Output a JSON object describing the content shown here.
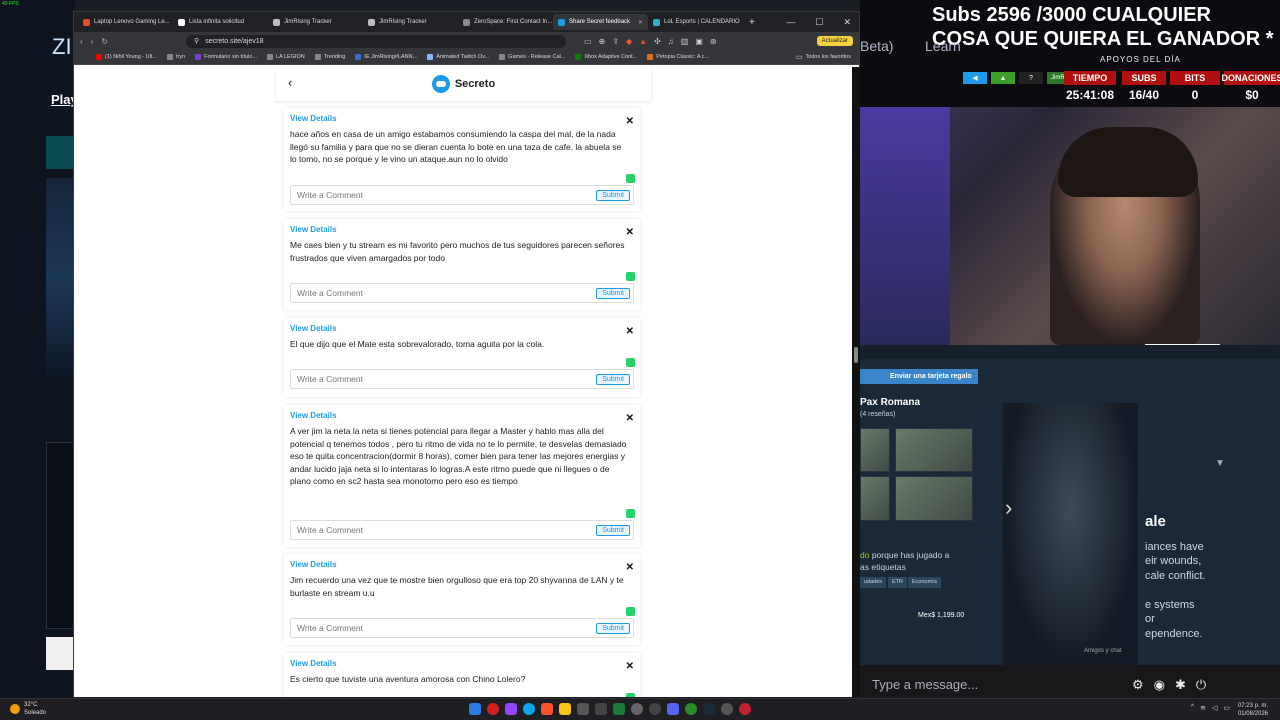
{
  "overlay": {
    "fps": "40 FPS",
    "subs_line1": "Subs 2596 /3000 CUALQUIER",
    "subs_line2": "COSA QUE QUIERA EL GANADOR *",
    "beta": "Beta)",
    "learn": "Learn",
    "apoyos": "APOYOS DEL DÍA",
    "twitch_name": "JimRising",
    "stats": [
      {
        "label": "TIEMPO",
        "value": "25:41:08"
      },
      {
        "label": "SUBS",
        "value": "16/40"
      },
      {
        "label": "BITS",
        "value": "0"
      },
      {
        "label": "DONACIONES",
        "value": "$0"
      }
    ]
  },
  "bg": {
    "zi": "ZI",
    "play": "Play",
    "p": "P",
    "f": "F"
  },
  "browser": {
    "tabs": [
      {
        "title": "Laptop Lenovo Gaming Le...",
        "color": "#e0502d"
      },
      {
        "title": "Lista infinita solicitud",
        "color": "#ffffff"
      },
      {
        "title": "JimRising Tracker",
        "color": "#bbbbbb"
      },
      {
        "title": "JimRising Tracker",
        "color": "#bbbbbb"
      },
      {
        "title": "ZeroSpace: First Contact In...",
        "color": "#888888"
      },
      {
        "title": "Share Secret feedback",
        "color": "#1e9be8",
        "active": true
      },
      {
        "title": "LoL Esports | CALENDARIO",
        "color": "#2db3c9"
      }
    ],
    "url": "secreto.site/ajev18",
    "update_label": "Actualizar",
    "bookmarks": [
      {
        "label": "(1) Nihil Young - Ult...",
        "color": "#ff0000"
      },
      {
        "label": "tryn",
        "color": "#888888"
      },
      {
        "label": "Formulario sin título...",
        "color": "#7b3fd1"
      },
      {
        "label": "LA LEGION",
        "color": "#888888"
      },
      {
        "label": "Trending",
        "color": "#888888"
      },
      {
        "label": "IE JimRising#LANN...",
        "color": "#3a6bd1"
      },
      {
        "label": "Animated Twitch Ov...",
        "color": "#8ab4f8"
      },
      {
        "label": "Games - Release Cal...",
        "color": "#888888"
      },
      {
        "label": "Xbox Adaptive Cont...",
        "color": "#107c10"
      },
      {
        "label": "Petopia Classic: A c...",
        "color": "#e07020"
      }
    ],
    "bookmarks_right": "Todos los favoritos"
  },
  "app": {
    "title": "Secreto",
    "view_details": "View Details",
    "comment_placeholder": "Write a Comment",
    "submit": "Submit",
    "cards": [
      {
        "text": "hace años en casa de un amigo estabamos consumiendo la caspa del mal, de la nada llegó su familia y para que no se dieran cuenta lo bote en una taza de cafe. la abuela se lo tomo, no se porque y le vino un ataque.aun no lo olvido"
      },
      {
        "text": "Me caes bien y tu stream es mi favorito pero muchos de tus seguidores parecen señores frustrados que viven amargados por todo"
      },
      {
        "text": "El que dijo que el Mate esta sobrevalorado, toma aguita por la cola."
      },
      {
        "text": "A ver jim la neta la neta si tienes potencial para llegar a Master y hablo mas alla del potencial q tenemos todos , pero tu ritmo de vida no te lo permite, te desvelas demasiado eso te quita concentracion(dormir 8 horas), comer bien para tener las mejores energias y andar lucido jaja neta si lo intentaras lo logras.A este ritmo puede que ni llegues o de plano como en sc2 hasta sea monotomo pero eso es tiempo"
      },
      {
        "text": "Jim recuerdo una vez que te mostre bien orgulloso que era top 20 shyvanna de LAN y te burlaste en stream u.u"
      },
      {
        "text": "Es cierto que tuviste una aventura amorosa con Chino Lolero?"
      }
    ]
  },
  "steam": {
    "gift": "Enviar una tarjeta regalo",
    "game": "Pax Romana",
    "reviews": "(4 reseñas)",
    "owned_green": "do",
    "owned_rest": " porque has jugado a",
    "owned_line2": "as etiquetas",
    "tags": [
      "udades",
      "ETR",
      "Economía"
    ],
    "price": "Mex$ 1,199.00",
    "right_title": "ale",
    "right_lines": [
      "iances have",
      "eir wounds,",
      "cale conflict.",
      "",
      "e systems",
      "or",
      "ependence."
    ],
    "amigos": "Amigos y chat"
  },
  "chat": {
    "placeholder": "Type a message..."
  },
  "taskbar": {
    "temp": "32°C",
    "weather": "Soleado",
    "time": "07:23 p. m.",
    "date": "01/08/2026"
  }
}
